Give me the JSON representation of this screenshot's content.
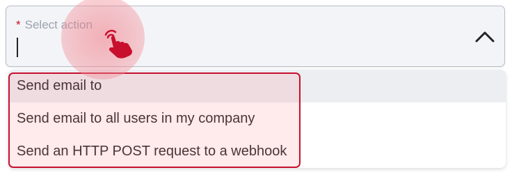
{
  "select": {
    "required_mark": "*",
    "placeholder": "Select action",
    "expanded": true,
    "chevron_icon": "chevron-up-icon"
  },
  "options": [
    {
      "label": "Send email to",
      "active": true
    },
    {
      "label": "Send email to all users in my company",
      "active": false
    },
    {
      "label": "Send an HTTP POST request to a webhook",
      "active": false
    }
  ],
  "annotations": {
    "tap_icon": "hand-pointer-icon",
    "highlight_color": "#c8102e"
  }
}
